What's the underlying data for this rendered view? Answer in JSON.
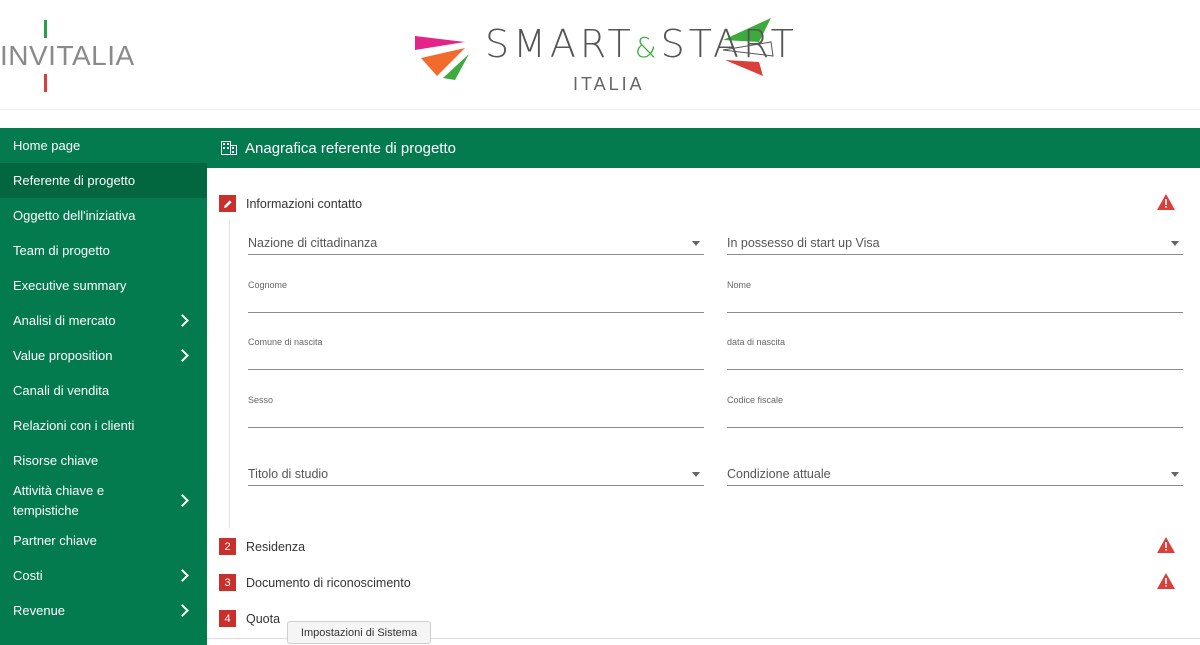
{
  "header": {
    "brand_left": "INVITALIA",
    "brand_center_smart": "SMART",
    "brand_center_amp": "&",
    "brand_center_start": "START",
    "brand_center_sub": "ITALIA"
  },
  "sidebar": {
    "items": [
      {
        "label": "Home page",
        "chevron": false
      },
      {
        "label": "Referente di progetto",
        "chevron": false,
        "active": true
      },
      {
        "label": "Oggetto dell'iniziativa",
        "chevron": false
      },
      {
        "label": "Team di progetto",
        "chevron": false
      },
      {
        "label": "Executive summary",
        "chevron": false
      },
      {
        "label": "Analisi di mercato",
        "chevron": true
      },
      {
        "label": "Value proposition",
        "chevron": true
      },
      {
        "label": "Canali di vendita",
        "chevron": false
      },
      {
        "label": "Relazioni con i clienti",
        "chevron": false
      },
      {
        "label": "Risorse chiave",
        "chevron": false
      },
      {
        "label": "Attività chiave e tempistiche",
        "chevron": true
      },
      {
        "label": "Partner chiave",
        "chevron": false
      },
      {
        "label": "Costi",
        "chevron": true
      },
      {
        "label": "Revenue",
        "chevron": true
      }
    ]
  },
  "main": {
    "title": "Anagrafica referente di progetto",
    "steps": [
      {
        "badge_icon": "pencil-icon",
        "label": "Informazioni contatto",
        "warning": true
      },
      {
        "badge": "2",
        "label": "Residenza",
        "warning": true
      },
      {
        "badge": "3",
        "label": "Documento di riconoscimento",
        "warning": true
      },
      {
        "badge": "4",
        "label": "Quota",
        "warning": false
      }
    ],
    "form": {
      "nazione": "Nazione di cittadinanza",
      "visa": "In possesso di start up Visa",
      "cognome": "Cognome",
      "nome": "Nome",
      "comune": "Comune di nascita",
      "data_nascita": "data di nascita",
      "sesso": "Sesso",
      "codice_fiscale": "Codice fiscale",
      "titolo_studio": "Titolo di studio",
      "condizione": "Condizione attuale"
    }
  },
  "tooltip": "Impostazioni di Sistema",
  "colors": {
    "primary_green": "#037b4f",
    "active_green": "#02663f",
    "badge_red": "#c9302c",
    "warning_red": "#d9403a"
  }
}
